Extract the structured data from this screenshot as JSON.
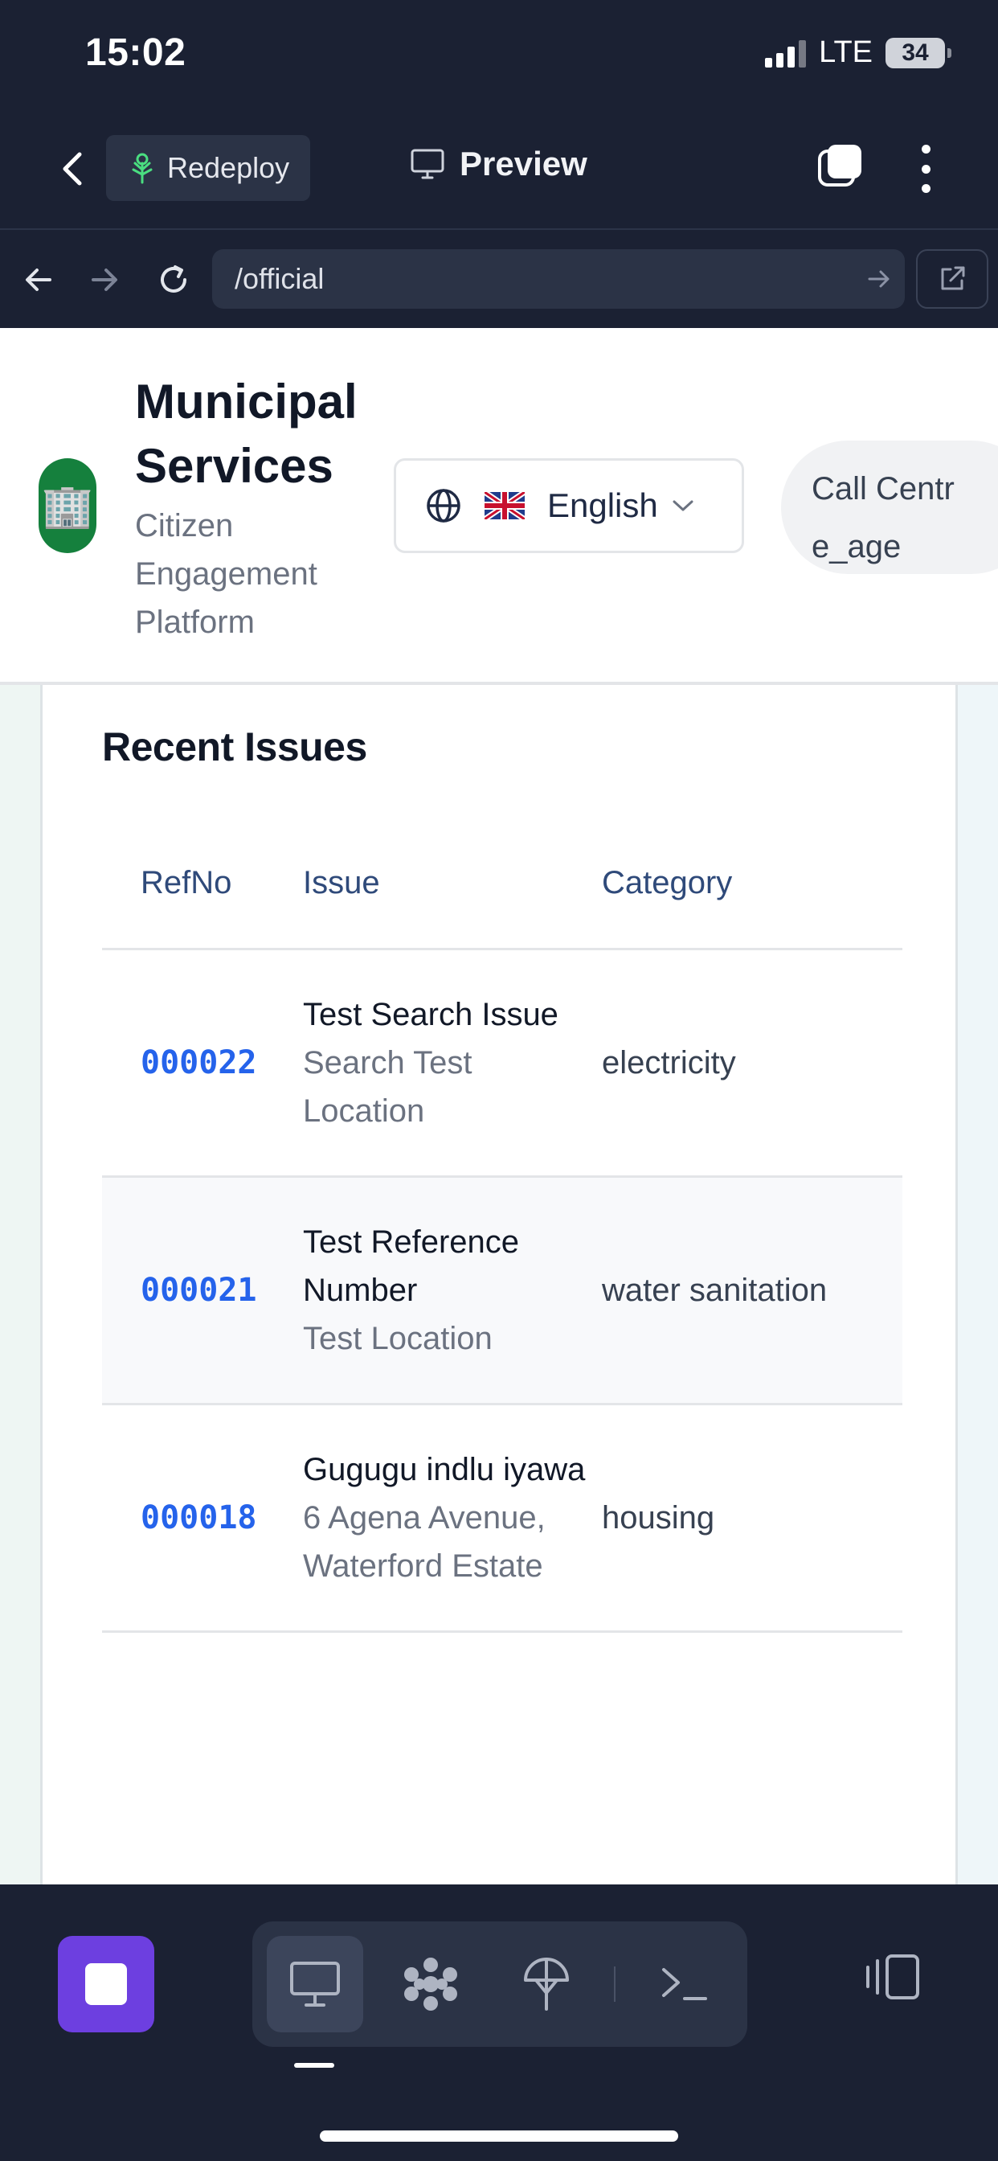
{
  "status_bar": {
    "time": "15:02",
    "network": "LTE",
    "battery": "34"
  },
  "top_nav": {
    "redeploy_label": "Redeploy",
    "preview_label": "Preview"
  },
  "url_bar": {
    "path": "/official"
  },
  "app": {
    "title": "Municipal Services",
    "subtitle": "Citizen Engagement Platform",
    "language": "English",
    "role": "Call Centre_age"
  },
  "recent_issues": {
    "title": "Recent Issues",
    "columns": [
      "RefNo",
      "Issue",
      "Category"
    ],
    "rows": [
      {
        "ref": "000022",
        "issue": "Test Search Issue",
        "location": "Search Test Location",
        "category": "electricity"
      },
      {
        "ref": "000021",
        "issue": "Test Reference Number",
        "location": "Test Location",
        "category": "water sanitation"
      },
      {
        "ref": "000018",
        "issue": "Gugugu indlu iyawa",
        "location": "6 Agena Avenue, Waterford Estate",
        "category": "housing"
      }
    ]
  },
  "colors": {
    "accent": "#6d3fe0",
    "ref_link": "#2563eb",
    "header_text": "#2f4a7a",
    "logo_bg": "#15803d",
    "chrome_bg": "#1b2133"
  },
  "icons": {
    "logo": "building-icon",
    "language": "globe-icon",
    "flag": "uk-flag-icon",
    "toolbar": [
      "stop-icon",
      "monitor-icon",
      "workspace-icon",
      "deploy-icon",
      "terminal-icon",
      "layout-icon"
    ]
  }
}
